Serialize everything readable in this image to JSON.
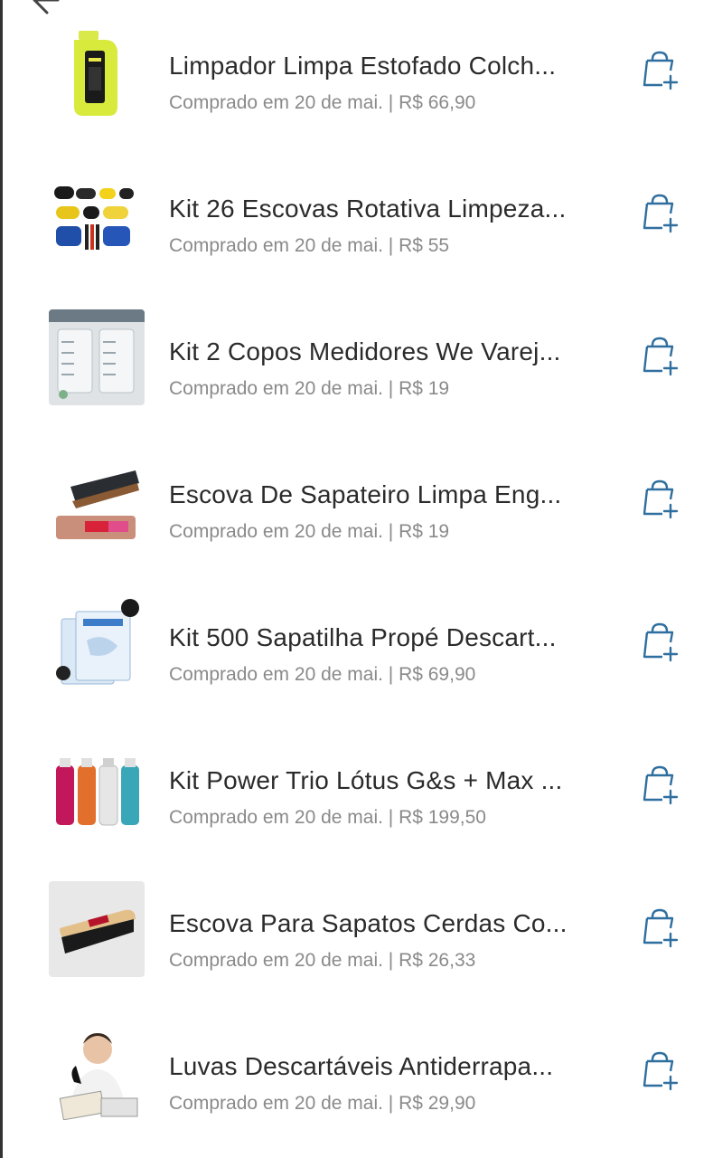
{
  "purchases": {
    "items": [
      {
        "title": "Limpador Limpa Estofado Colch...",
        "meta": "Comprado em 20 de mai. | R$ 66,90",
        "image": "yellow-bottle-product-image"
      },
      {
        "title": "Kit 26 Escovas Rotativa Limpeza...",
        "meta": "Comprado em 20 de mai. | R$ 55",
        "image": "rotary-brushes-product-image"
      },
      {
        "title": "Kit 2 Copos Medidores We Varej...",
        "meta": "Comprado em 20 de mai. | R$ 19",
        "image": "measuring-cups-product-image"
      },
      {
        "title": "Escova De Sapateiro Limpa Eng...",
        "meta": "Comprado em 20 de mai. | R$ 19",
        "image": "shoe-brush-product-image"
      },
      {
        "title": "Kit 500 Sapatilha Propé Descart...",
        "meta": "Comprado em 20 de mai. | R$ 69,90",
        "image": "shoe-covers-product-image"
      },
      {
        "title": "Kit Power Trio Lótus G&s + Max ...",
        "meta": "Comprado em 20 de mai. | R$ 199,50",
        "image": "bottle-trio-product-image"
      },
      {
        "title": "Escova Para Sapatos Cerdas Co...",
        "meta": "Comprado em 20 de mai. | R$ 26,33",
        "image": "wooden-shoe-brush-product-image"
      },
      {
        "title": "Luvas Descartáveis Antiderrapa...",
        "meta": "Comprado em 20 de mai. | R$ 29,90",
        "image": "disposable-gloves-product-image"
      }
    ]
  },
  "icons": {
    "add_to_cart": "bag-plus-icon",
    "back": "back-arrow-icon"
  },
  "colors": {
    "accent": "#2f6f9f",
    "title": "#2b2b2b",
    "meta": "#8a8a8a"
  }
}
